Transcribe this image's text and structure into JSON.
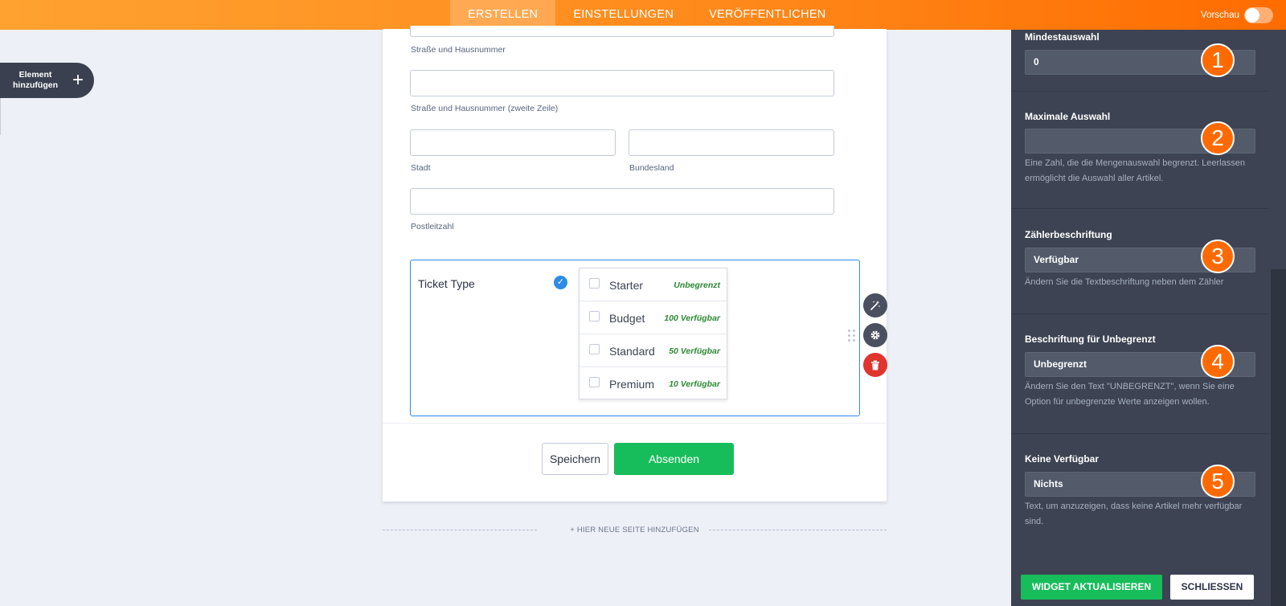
{
  "topbar": {
    "tabs": [
      {
        "label": "ERSTELLEN",
        "active": true
      },
      {
        "label": "EINSTELLUNGEN",
        "active": false
      },
      {
        "label": "VERÖFFENTLICHEN",
        "active": false
      }
    ],
    "preview_label": "Vorschau",
    "preview_enabled": false,
    "accent_start": "#ffa230",
    "accent_end": "#ff6c00"
  },
  "add_element": {
    "label": "Element\nhinzufügen",
    "icon": "plus-icon"
  },
  "form": {
    "fields": {
      "street_label": "Straße und Hausnummer",
      "street2_label": "Straße und Hausnummer (zweite Zeile)",
      "city_label": "Stadt",
      "state_label": "Bundesland",
      "zip_label": "Postleitzahl"
    },
    "ticket": {
      "label": "Ticket Type",
      "options": [
        {
          "name": "Starter",
          "availability": "Unbegrenzt"
        },
        {
          "name": "Budget",
          "availability": "100 Verfügbar"
        },
        {
          "name": "Standard",
          "availability": "50 Verfügbar"
        },
        {
          "name": "Premium",
          "availability": "10 Verfügbar"
        }
      ]
    },
    "save_label": "Speichern",
    "submit_label": "Absenden",
    "add_page_label": "+ HIER NEUE SEITE HINZUFÜGEN"
  },
  "tools": [
    "magic-wand-icon",
    "gear-icon",
    "trash-icon"
  ],
  "panel": {
    "sections": [
      {
        "number": "1",
        "title": "Mindestauswahl",
        "value": "0",
        "help": ""
      },
      {
        "number": "2",
        "title": "Maximale Auswahl",
        "value": "",
        "help": "Eine Zahl, die die Mengenauswahl begrenzt. Leerlassen ermöglicht die Auswahl aller Artikel."
      },
      {
        "number": "3",
        "title": "Zählerbeschriftung",
        "value": "Verfügbar",
        "help": "Ändern Sie die Textbeschriftung neben dem Zähler"
      },
      {
        "number": "4",
        "title": "Beschriftung für Unbegrenzt",
        "value": "Unbegrenzt",
        "help": "Ändern Sie den Text \"UNBEGRENZT\", wenn Sie eine Option für unbegrenzte Werte anzeigen wollen."
      },
      {
        "number": "5",
        "title": "Keine Verfügbar",
        "value": "Nichts",
        "help": "Text, um anzuzeigen, dass keine Artikel mehr verfügbar sind."
      }
    ],
    "update_label": "WIDGET AKTUALISIEREN",
    "close_label": "SCHLIESSEN",
    "badge_color": "#ff6a00"
  }
}
